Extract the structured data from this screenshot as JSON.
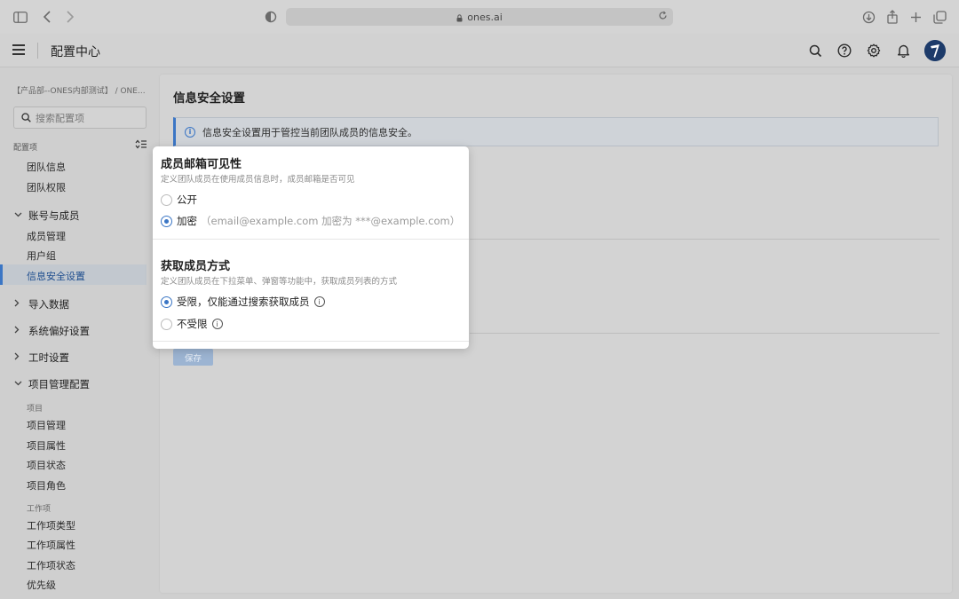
{
  "browser": {
    "url": "ones.ai"
  },
  "header": {
    "title": "配置中心"
  },
  "sidebar": {
    "org": "【产品部--ONES内部测试】 / ONE...",
    "search_placeholder": "搜索配置项",
    "section_label": "配置项",
    "items": [
      {
        "label": "团队信息"
      },
      {
        "label": "团队权限"
      }
    ],
    "account_group": {
      "label": "账号与成员",
      "items": [
        {
          "label": "成员管理"
        },
        {
          "label": "用户组"
        },
        {
          "label": "信息安全设置"
        }
      ]
    },
    "import_group": {
      "label": "导入数据"
    },
    "prefs_group": {
      "label": "系统偏好设置"
    },
    "hours_group": {
      "label": "工时设置"
    },
    "project_group": {
      "label": "项目管理配置",
      "sub_project": "项目",
      "project_items": [
        {
          "label": "项目管理"
        },
        {
          "label": "项目属性"
        },
        {
          "label": "项目状态"
        },
        {
          "label": "项目角色"
        }
      ],
      "sub_workitem": "工作项",
      "workitem_items": [
        {
          "label": "工作项类型"
        },
        {
          "label": "工作项属性"
        },
        {
          "label": "工作项状态"
        },
        {
          "label": "优先级"
        }
      ]
    }
  },
  "main": {
    "title": "信息安全设置",
    "banner": "信息安全设置用于管控当前团队成员的信息安全。",
    "save_label": "保存"
  },
  "popup": {
    "email_section": {
      "title": "成员邮箱可见性",
      "desc": "定义团队成员在使用成员信息时，成员邮箱是否可见",
      "options": [
        {
          "label": "公开",
          "hint": "",
          "selected": false
        },
        {
          "label": "加密",
          "hint": "（email@example.com 加密为 ***@example.com）",
          "selected": true
        }
      ]
    },
    "member_section": {
      "title": "获取成员方式",
      "desc": "定义团队成员在下拉菜单、弹窗等功能中，获取成员列表的方式",
      "options": [
        {
          "label": "受限，仅能通过搜索获取成员",
          "selected": true
        },
        {
          "label": "不受限",
          "selected": false
        }
      ]
    }
  },
  "colors": {
    "accent": "#3b76c5",
    "page_bg": "#cfcfcf",
    "popup_bg": "#ffffff"
  }
}
